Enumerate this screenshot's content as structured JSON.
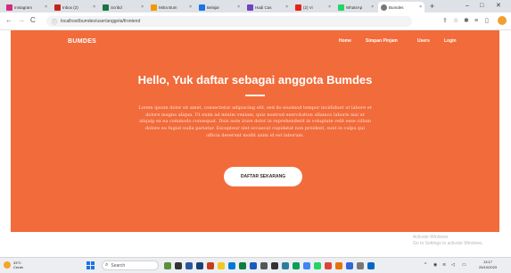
{
  "browser": {
    "tabs": [
      {
        "label": "Instagram",
        "color": "#d6287c"
      },
      {
        "label": "Inbox (2)",
        "color": "#c5221f"
      },
      {
        "label": "Scribd",
        "color": "#1e7145"
      },
      {
        "label": "Mitra Bum",
        "color": "#f29900"
      },
      {
        "label": "Belajar",
        "color": "#1a73e8"
      },
      {
        "label": "Hadi Cas",
        "color": "#6f42c1"
      },
      {
        "label": "(2) Vi",
        "color": "#e62117"
      },
      {
        "label": "WhatsAp",
        "color": "#25d366"
      },
      {
        "label": "Bumdes",
        "color": "#777777",
        "active": true
      }
    ],
    "new_tab": "+",
    "window_controls": {
      "minimize": "–",
      "maximize": "□",
      "close": "✕"
    },
    "nav": {
      "back": "←",
      "forward": "→",
      "reload": "C"
    },
    "url": "localhost/bumdes/user/anggota/frontend",
    "lock": "ⓘ"
  },
  "site": {
    "brand": "BUMDES",
    "nav": [
      "Home",
      "Simpan Pinjam",
      "Users",
      "Login"
    ],
    "hero_title": "Hello, Yuk daftar sebagai anggota Bumdes",
    "hero_text": "Lorem ipsum dolor sit amet, consectetur adipiscing elit, sed do eiusmod tempor incididunt ut labore et dolore magna aliqua. Ut enim ad minim veniam, quis nostrud exercitation ullamco laboris nisi ut aliquip ex ea commodo consequat. Duis aute irure dolor in reprehenderit in voluptate velit esse cillum dolore eu fugiat nulla pariatur. Excepteur sint occaecat cupidatat non proident, sunt in culpa qui officia deserunt mollit anim id est laborum.",
    "cta": "DAFTAR SEKARANG",
    "accent": "#f26b3a"
  },
  "watermark": {
    "line1": "Activate Windows",
    "line2": "Go to Settings to activate Windows."
  },
  "taskbar": {
    "temp": "33°C",
    "condition": "Cerah",
    "search": "Search",
    "time": "13:17",
    "date": "25/10/2023"
  }
}
